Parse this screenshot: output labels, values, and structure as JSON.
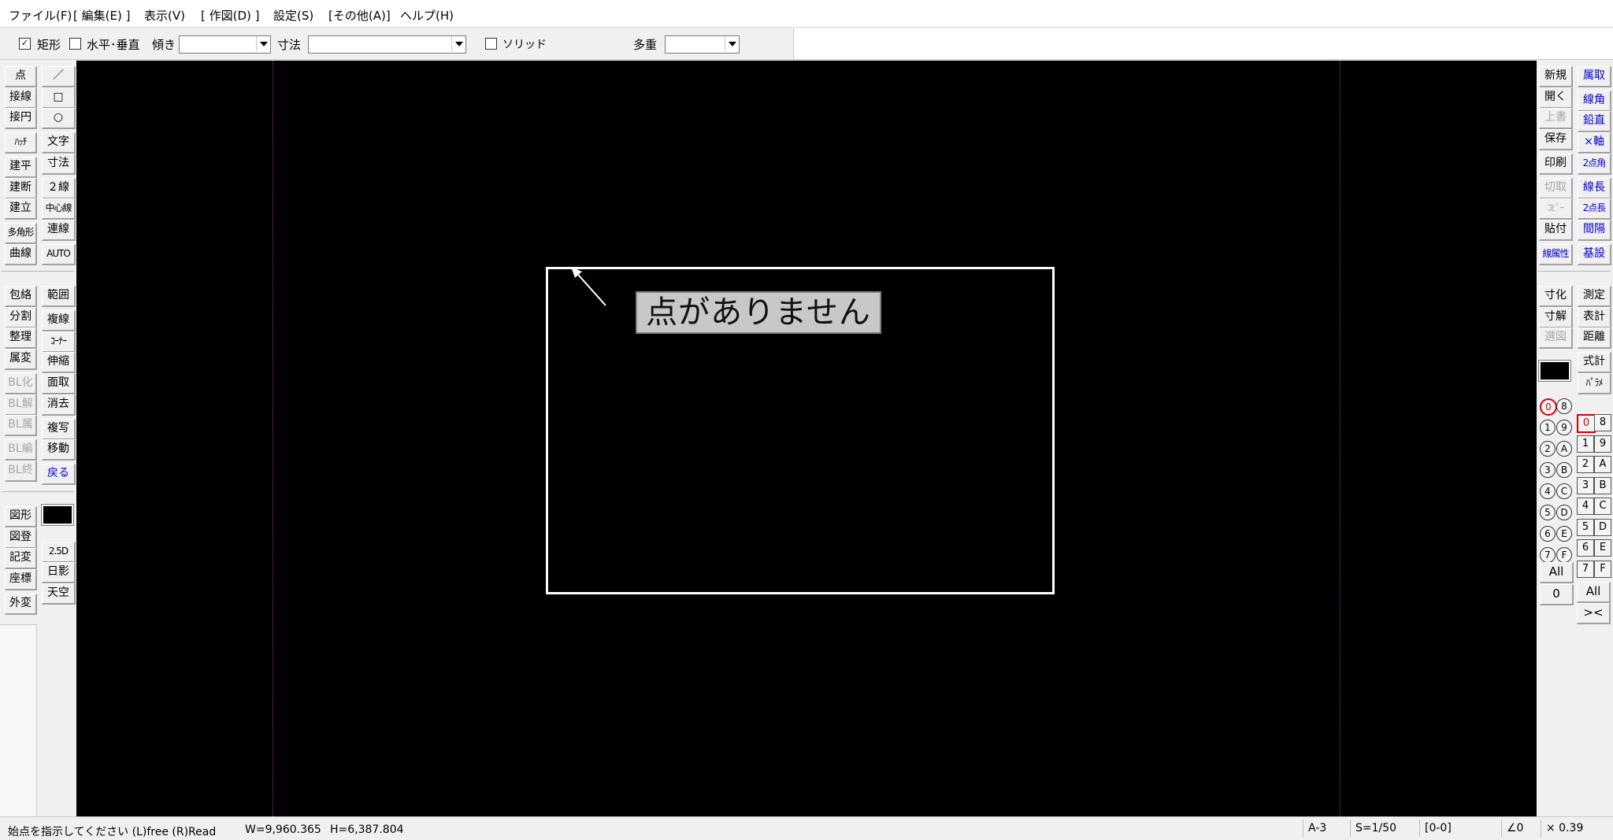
{
  "menu": [
    "ファイル(F)",
    "[ 編集(E) ]",
    "表示(V)",
    "[ 作図(D) ]",
    "設定(S)",
    "[その他(A)]",
    "ヘルプ(H)"
  ],
  "options": {
    "rect_check": "✓",
    "rect_label": "矩形",
    "hv_label": "水平･垂直",
    "slope_label": "傾き",
    "dim_label": "寸法",
    "solid_label": "ソリッド",
    "multi_label": "多重"
  },
  "left_toolbar": {
    "col1a": [
      "点",
      "接線",
      "接円",
      "ﾊｯﾁ",
      "建平",
      "建断",
      "建立",
      "多角形",
      "曲線"
    ],
    "col2a": [
      "／",
      "□",
      "○",
      "文字",
      "寸法",
      "２線",
      "中心線",
      "連線",
      "AUTO"
    ],
    "col1b": [
      "包絡",
      "分割",
      "整理",
      "属変",
      "BL化",
      "BL解",
      "BL属",
      "BL編",
      "BL終"
    ],
    "col2b": [
      "範囲",
      "複線",
      "ｺｰﾅｰ",
      "伸縮",
      "面取",
      "消去",
      "複写",
      "移動",
      "戻る"
    ],
    "col1c": [
      "図形",
      "図登",
      "記変",
      "座標",
      "外変"
    ],
    "col2c": [
      "2.5D",
      "日影",
      "天空"
    ]
  },
  "right_toolbar": {
    "col1a": [
      "新規",
      "開く",
      "上書",
      "保存",
      "印刷",
      "切取",
      "ｺﾋﾟｰ",
      "貼付",
      "線属性"
    ],
    "col2a": [
      "属取",
      "線角",
      "鉛直",
      "×軸",
      "2点角",
      "線長",
      "2点長",
      "間隔",
      "基設"
    ],
    "col1b": [
      "寸化",
      "寸解",
      "選図"
    ],
    "col2b": [
      "測定",
      "表計",
      "距離",
      "式計",
      "ﾊﾟﾗﾒ"
    ],
    "layer_group_left": [
      "0",
      "1",
      "2",
      "3",
      "4",
      "5",
      "6",
      "7"
    ],
    "layer_group_right": [
      "8",
      "9",
      "A",
      "B",
      "C",
      "D",
      "E",
      "F"
    ],
    "layer_all": "All",
    "layer_zero": "0",
    "layer_left": [
      "0",
      "1",
      "2",
      "3",
      "4",
      "5",
      "6",
      "7"
    ],
    "layer_right": [
      "8",
      "9",
      "A",
      "B",
      "C",
      "D",
      "E",
      "F"
    ],
    "layer_all2": "All",
    "layer_close": "><"
  },
  "canvas": {
    "tooltip": "点がありません",
    "background": "#000000",
    "guide_color": "#a0339a"
  },
  "status": {
    "prompt": "始点を指示してください (L)free (R)Read",
    "width": "W=9,960.365",
    "height": "H=6,387.804",
    "paper": "A-3",
    "scale": "S=1/50",
    "layer": "[0-0]",
    "angle": "∠0",
    "zoom": "× 0.39"
  }
}
